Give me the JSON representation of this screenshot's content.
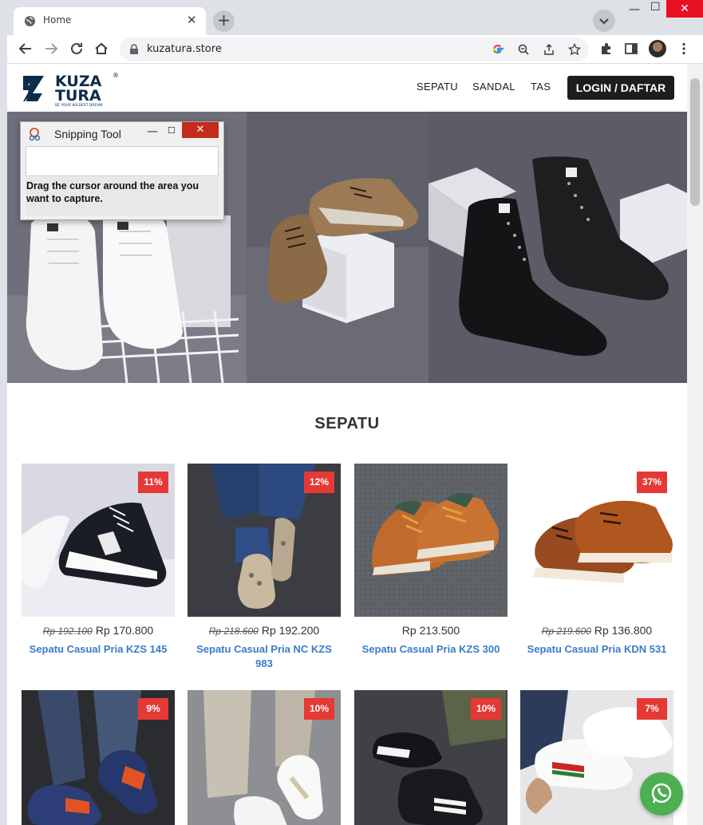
{
  "browser": {
    "tab_title": "Home",
    "tab_close": "✕",
    "new_tab": "+",
    "url": "kuzatura.store",
    "window_minimize": "—",
    "window_maximize": "☐",
    "window_close": "✕"
  },
  "site": {
    "logo_text_top": "KUZA",
    "logo_text_bottom": "TURA",
    "logo_tagline": "BE YOUR WILDEST DREAM",
    "nav": [
      "SEPATU",
      "SANDAL",
      "TAS"
    ],
    "login_label": "LOGIN / DAFTAR"
  },
  "section_title": "SEPATU",
  "products": [
    {
      "discount": "11%",
      "old_price": "Rp 192.100",
      "price": "Rp 170.800",
      "name": "Sepatu Casual Pria KZS 145"
    },
    {
      "discount": "12%",
      "old_price": "Rp 218.600",
      "price": "Rp 192.200",
      "name": "Sepatu Casual Pria NC KZS 983"
    },
    {
      "discount": "",
      "old_price": "",
      "price": "Rp 213.500",
      "name": "Sepatu Casual Pria KZS 300"
    },
    {
      "discount": "37%",
      "old_price": "Rp 219.600",
      "price": "Rp 136.800",
      "name": "Sepatu Casual Pria KDN 531"
    },
    {
      "discount": "9%"
    },
    {
      "discount": "10%"
    },
    {
      "discount": "10%"
    },
    {
      "discount": "7%"
    }
  ],
  "snipping_tool": {
    "title": "Snipping Tool",
    "minimize": "—",
    "maximize": "☐",
    "close": "✕",
    "message": "Drag the cursor around the area you want to capture."
  },
  "colors": {
    "accent_dark": "#1d1d1d",
    "badge_red": "#e53935",
    "product_link": "#3a7cc4",
    "whatsapp": "#4caf50"
  },
  "icons": [
    "globe-icon",
    "back-icon",
    "forward-icon",
    "reload-icon",
    "home-icon",
    "lock-icon",
    "google-icon",
    "zoom-out-icon",
    "share-icon",
    "star-icon",
    "extensions-icon",
    "sidebar-icon",
    "menu-icon",
    "whatsapp-icon"
  ]
}
